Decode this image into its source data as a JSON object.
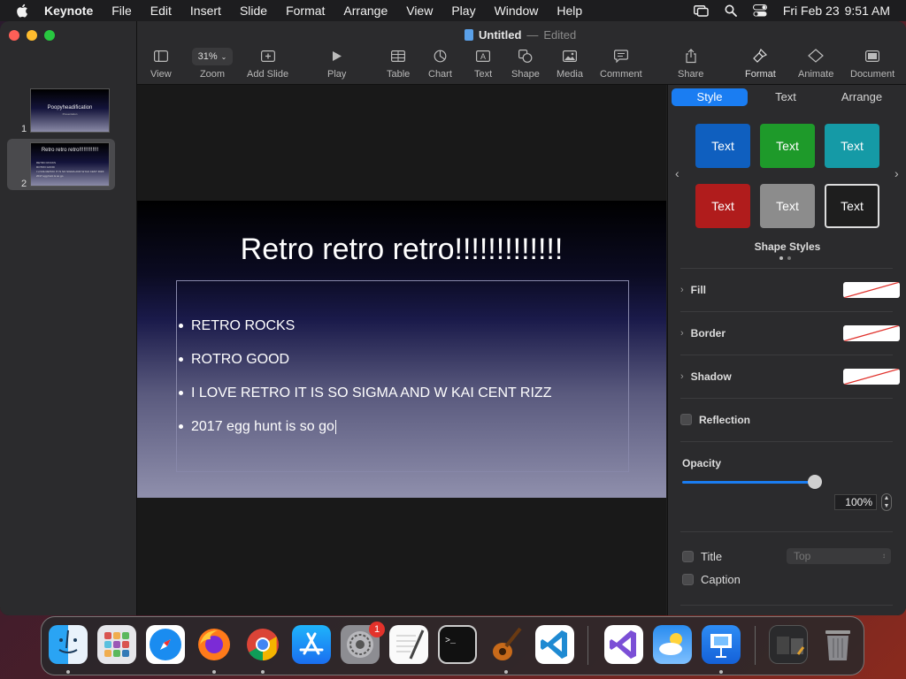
{
  "menubar": {
    "app": "Keynote",
    "items": [
      "File",
      "Edit",
      "Insert",
      "Slide",
      "Format",
      "Arrange",
      "View",
      "Play",
      "Window",
      "Help"
    ],
    "date": "Fri Feb 23",
    "time": "9:51 AM"
  },
  "window": {
    "doc_name": "Untitled",
    "doc_sep": "—",
    "doc_status": "Edited"
  },
  "toolbar": {
    "view": "View",
    "zoom_value": "31%",
    "zoom": "Zoom",
    "add_slide": "Add Slide",
    "play": "Play",
    "table": "Table",
    "chart": "Chart",
    "text": "Text",
    "shape": "Shape",
    "media": "Media",
    "comment": "Comment",
    "share": "Share",
    "format": "Format",
    "animate": "Animate",
    "document": "Document"
  },
  "navigator": {
    "slides": [
      {
        "num": "1",
        "title": "Poopyheadification",
        "subtitle": "Presentation"
      },
      {
        "num": "2",
        "title": "Retro retro retro!!!!!!!!!!!!!",
        "bullets": [
          "RETRO ROCKS",
          "ROTRO GOOD",
          "I LOVE RETRO IT IS SO SIGMA AND W KAI CENT RIZZ",
          "2017 egg hunt is so go"
        ]
      }
    ]
  },
  "slide": {
    "title": "Retro retro retro!!!!!!!!!!!!!",
    "bullets": [
      "RETRO ROCKS",
      "ROTRO GOOD",
      "I LOVE RETRO IT IS SO SIGMA AND W KAI CENT RIZZ",
      "2017 egg hunt is so go"
    ]
  },
  "inspector": {
    "tabs": [
      "Style",
      "Text",
      "Arrange"
    ],
    "swatch_label": "Text",
    "swatch_colors": [
      "#0f5fbf",
      "#1e9a2a",
      "#159aa6",
      "#b01c1c",
      "#8c8c8c",
      "#1e1e1e"
    ],
    "shape_styles_label": "Shape Styles",
    "fill": "Fill",
    "border": "Border",
    "shadow": "Shadow",
    "reflection": "Reflection",
    "opacity_label": "Opacity",
    "opacity_value": "100%",
    "opacity_fraction": 1.0,
    "title_label": "Title",
    "title_position": "Top",
    "caption_label": "Caption"
  },
  "colors": {
    "accent": "#1a7df2",
    "close": "#fe5f57",
    "minimize": "#febc2e",
    "zoom": "#28c840"
  },
  "dock": {
    "apps": [
      "finder-icon",
      "launchpad-icon",
      "safari-icon",
      "firefox-icon",
      "chrome-icon",
      "app-store-icon",
      "system-settings-icon",
      "textedit-icon",
      "terminal-icon",
      "garageband-icon",
      "vscode-icon",
      "visual-studio-icon",
      "weather-icon",
      "keynote-icon",
      "downloads-icon",
      "trash-icon"
    ],
    "settings_badge": "1"
  }
}
